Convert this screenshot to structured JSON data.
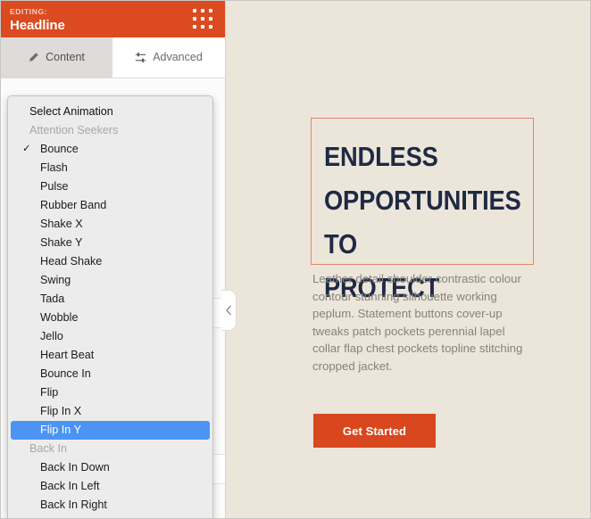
{
  "editor": {
    "header": {
      "editing_label": "EDITING:",
      "title": "Headline",
      "drag_handle_icon": "grid-dots-icon"
    },
    "tabs": [
      {
        "label": "Content",
        "icon": "pencil-icon",
        "active": true
      },
      {
        "label": "Advanced",
        "icon": "sliders-icon",
        "active": false
      }
    ],
    "collapse_handle_icon": "chevron-left-icon"
  },
  "animation_dropdown": {
    "title": "Select Animation",
    "selected_value": "Flip In Y",
    "checked_value": "Bounce",
    "items": [
      {
        "label": "Select Animation",
        "type": "title"
      },
      {
        "label": "Attention Seekers",
        "type": "group"
      },
      {
        "label": "Bounce",
        "type": "option",
        "checked": true
      },
      {
        "label": "Flash",
        "type": "option"
      },
      {
        "label": "Pulse",
        "type": "option"
      },
      {
        "label": "Rubber Band",
        "type": "option"
      },
      {
        "label": "Shake X",
        "type": "option"
      },
      {
        "label": "Shake Y",
        "type": "option"
      },
      {
        "label": "Head Shake",
        "type": "option"
      },
      {
        "label": "Swing",
        "type": "option"
      },
      {
        "label": "Tada",
        "type": "option"
      },
      {
        "label": "Wobble",
        "type": "option"
      },
      {
        "label": "Jello",
        "type": "option"
      },
      {
        "label": "Heart Beat",
        "type": "option"
      },
      {
        "label": "Bounce In",
        "type": "option"
      },
      {
        "label": "Flip",
        "type": "option"
      },
      {
        "label": "Flip In X",
        "type": "option"
      },
      {
        "label": "Flip In Y",
        "type": "option",
        "selected": true
      },
      {
        "label": "Back In",
        "type": "group"
      },
      {
        "label": "Back In Down",
        "type": "option"
      },
      {
        "label": "Back In Left",
        "type": "option"
      },
      {
        "label": "Back In Right",
        "type": "option"
      }
    ],
    "check_glyph": "✓"
  },
  "canvas": {
    "headline": "ENDLESS\nOPPORTUNITIES TO\nPROTECT",
    "body": "Leather detail shoulder contrastic colour contour stunning silhouette working peplum. Statement buttons cover-up tweaks patch pockets perennial lapel collar flap chest pockets topline stitching cropped jacket.",
    "cta_label": "Get Started"
  },
  "colors": {
    "header_orange": "#dc4a20",
    "cta_orange": "#d9471f",
    "selection_blue": "#4b94f4",
    "canvas_beige": "#ece5d9",
    "headline_navy": "#1e2a44",
    "headline_border_salmon": "#e3866a",
    "dropdown_bg": "#ececec"
  }
}
